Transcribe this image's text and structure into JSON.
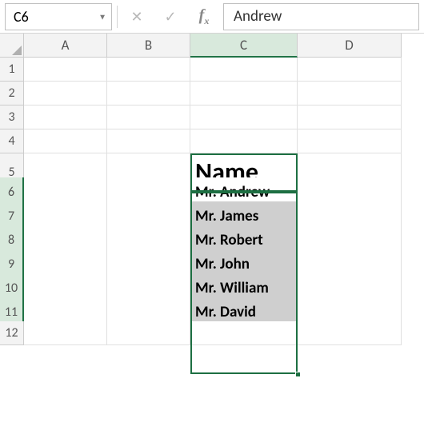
{
  "namebox": {
    "value": "C6"
  },
  "formula": {
    "value": "Andrew"
  },
  "columns": [
    "A",
    "B",
    "C",
    "D"
  ],
  "rows": [
    "1",
    "2",
    "3",
    "4",
    "5",
    "6",
    "7",
    "8",
    "9",
    "10",
    "11",
    "12"
  ],
  "cells": {
    "C5": "Name",
    "C6": "Mr. Andrew",
    "C7": "Mr. James",
    "C8": "Mr. Robert",
    "C9": "Mr. John",
    "C10": "Mr. William",
    "C11": "Mr. David"
  },
  "buttons": {
    "cancel_glyph": "✕",
    "enter_glyph": "✓",
    "fx_glyph": "fx"
  }
}
